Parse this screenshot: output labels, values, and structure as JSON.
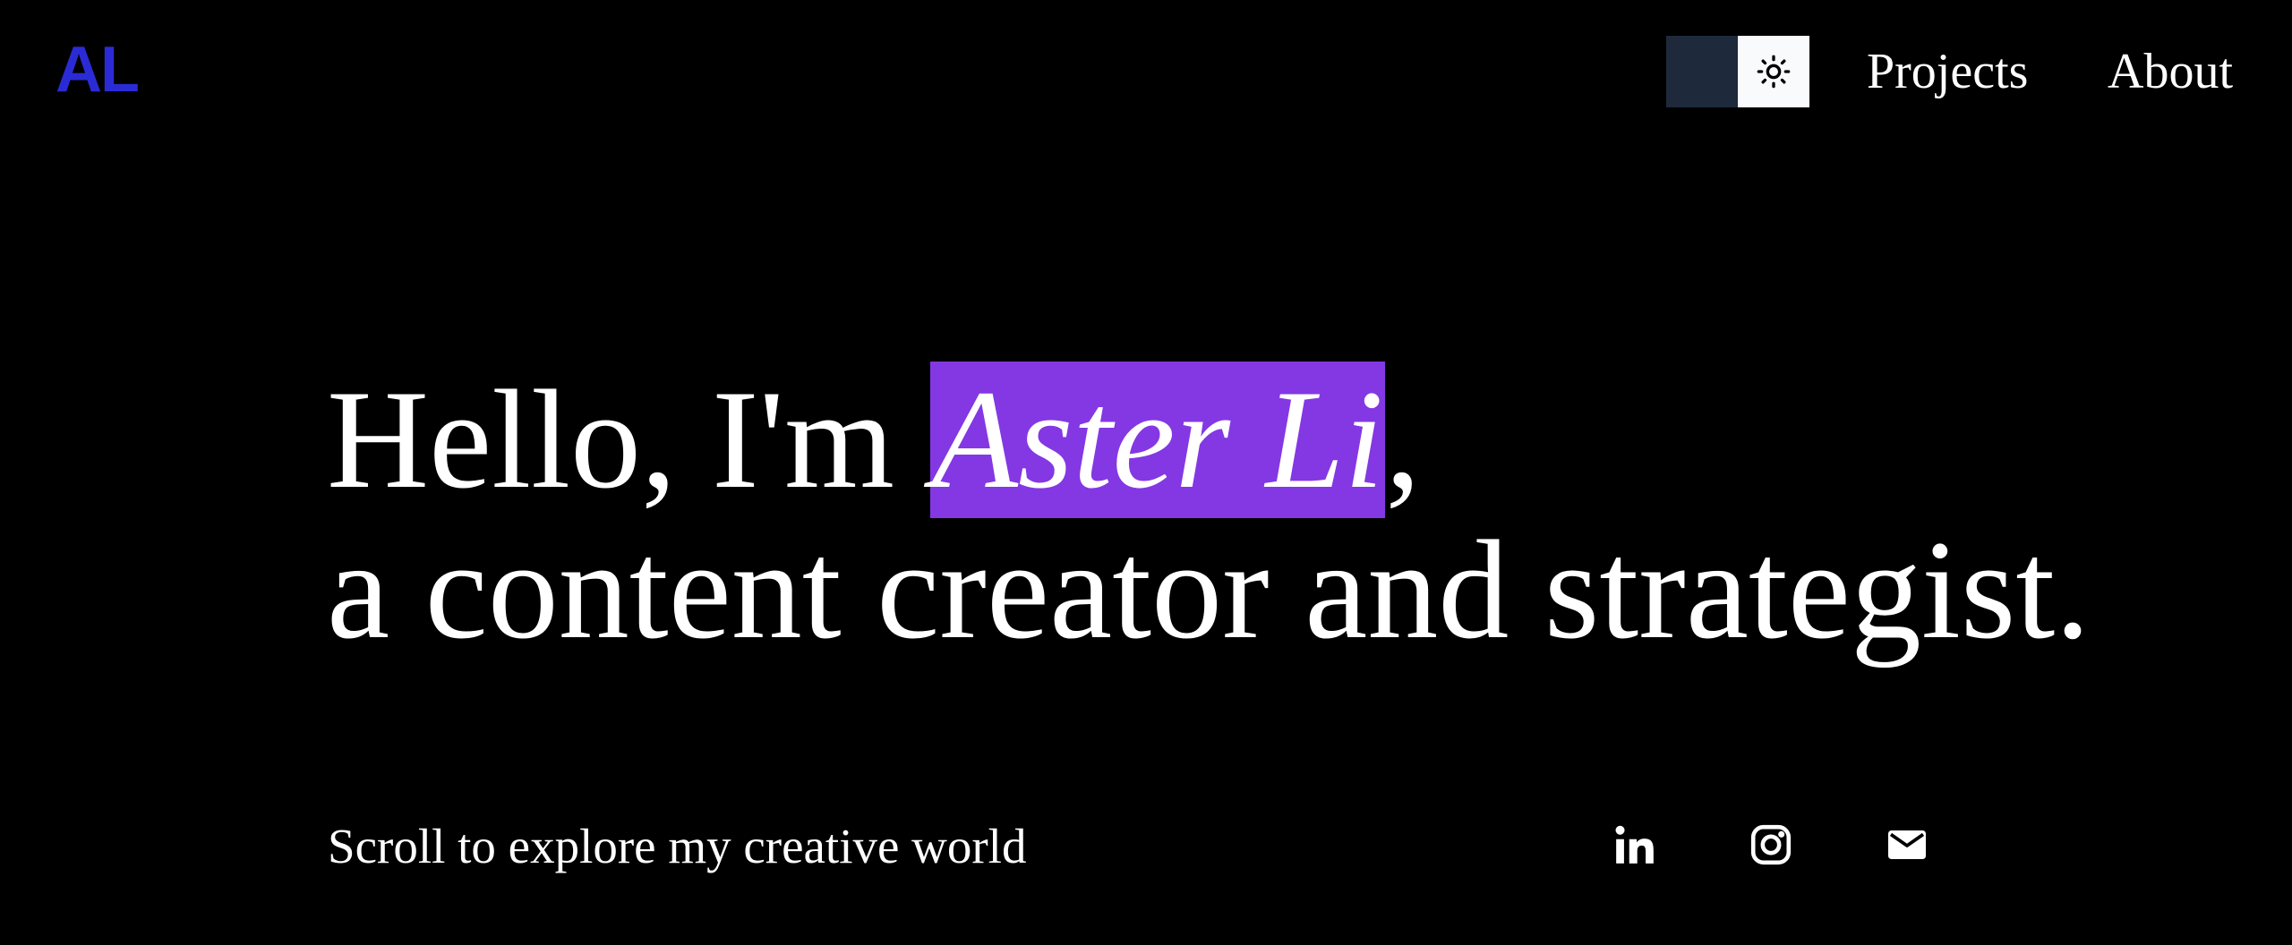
{
  "header": {
    "logo": "AL",
    "nav": {
      "projects": "Projects",
      "about": "About"
    },
    "theme_toggle_icon": "sun-icon"
  },
  "hero": {
    "greeting_prefix": "Hello, I'm ",
    "name": "Aster Li",
    "greeting_suffix": ",",
    "tagline": "a content creator and strategist.",
    "scroll_hint": "Scroll to explore my creative world"
  },
  "social": {
    "icons": [
      "linkedin-icon",
      "instagram-icon",
      "email-icon"
    ]
  },
  "colors": {
    "background": "#000000",
    "logo": "#2b2bd6",
    "highlight": "#8338e3",
    "toggle_dark": "#1e293b",
    "toggle_light": "#f8fafc",
    "text": "#ffffff"
  }
}
